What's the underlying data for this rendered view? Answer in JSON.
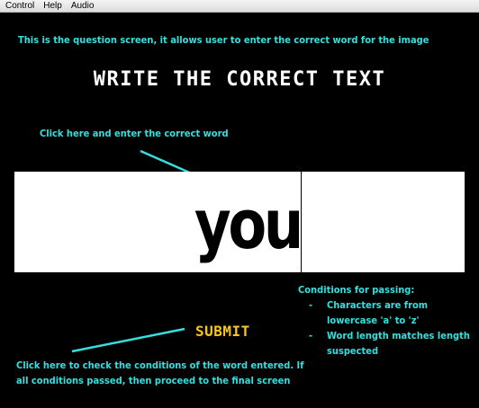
{
  "menu": {
    "items": [
      {
        "label": "Control"
      },
      {
        "label": "Help"
      },
      {
        "label": "Audio"
      }
    ]
  },
  "annotations": {
    "top": "This is the question screen, it allows user to enter the correct word for the image",
    "click_here": "Click here and enter the correct word",
    "bottom": "Click here to check the conditions of the word entered. If all conditions passed, then proceed to the final screen",
    "conditions_title": "Conditions for passing:",
    "conditions": [
      "Characters are from lowercase 'a' to 'z'",
      "Word length matches length suspected"
    ]
  },
  "screen": {
    "title": "WRITE THE CORRECT TEXT",
    "input_value": "you",
    "submit_label": "SUBMIT"
  },
  "colors": {
    "annotation": "#33e0e0",
    "submit": "#f7c51b",
    "background": "#000000"
  }
}
